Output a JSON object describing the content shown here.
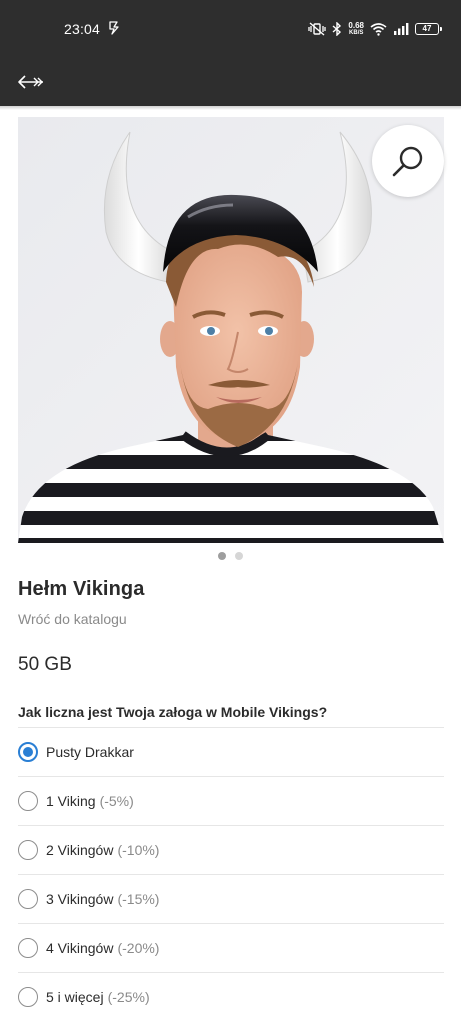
{
  "status_bar": {
    "time": "23:04",
    "net_speed_value": "0.68",
    "net_speed_unit": "KB/S",
    "battery": "47"
  },
  "app_bar": {
    "back_icon": "back-arrow-icon"
  },
  "product": {
    "image_description_icon": "viking-helmet-photo",
    "zoom_icon": "magnifier-icon",
    "carousel_pages": 2,
    "carousel_active": 1,
    "title": "Hełm Vikinga",
    "back_link": "Wróć do katalogu",
    "data": "50 GB"
  },
  "crew_question": {
    "label": "Jak liczna jest Twoja załoga w Mobile Vikings?",
    "selected_index": 0,
    "options": [
      {
        "label": "Pusty Drakkar",
        "discount": ""
      },
      {
        "label": "1 Viking",
        "discount": "(-5%)"
      },
      {
        "label": "2 Vikingów",
        "discount": "(-10%)"
      },
      {
        "label": "3 Vikingów",
        "discount": "(-15%)"
      },
      {
        "label": "4 Vikingów",
        "discount": "(-20%)"
      },
      {
        "label": "5 i więcej",
        "discount": "(-25%)"
      }
    ]
  },
  "colors": {
    "bar_background": "#2e2e2e",
    "accent": "#2a7fd4",
    "muted_text": "#8a8a8a"
  }
}
